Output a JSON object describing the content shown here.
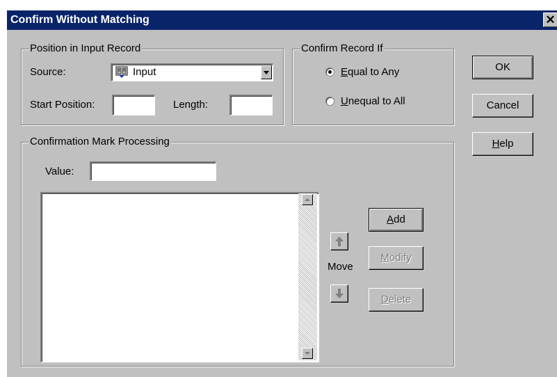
{
  "title": "Confirm Without Matching",
  "close_glyph": "✕",
  "position_group": {
    "label": "Position in Input Record",
    "source_label": "Source:",
    "source_value": "Input",
    "start_label": "Start Position:",
    "start_value": "",
    "length_label": "Length:",
    "length_value": ""
  },
  "confirm_group": {
    "label": "Confirm Record If",
    "options": [
      {
        "label": "Equal to Any",
        "accel": "E",
        "rest": "qual to Any",
        "selected": true
      },
      {
        "label": "Unequal to All",
        "accel": "U",
        "rest": "nequal to All",
        "selected": false
      }
    ]
  },
  "buttons": {
    "ok": "OK",
    "cancel": "Cancel",
    "help_accel": "H",
    "help_rest": "elp"
  },
  "mark_group": {
    "label": "Confirmation Mark Processing",
    "value_label": "Value:",
    "value": "",
    "list_items": [],
    "move_label": "Move",
    "add_accel": "A",
    "add_rest": "dd",
    "modify_accel": "M",
    "modify_rest": "odify",
    "delete_accel": "D",
    "delete_rest": "elete"
  }
}
